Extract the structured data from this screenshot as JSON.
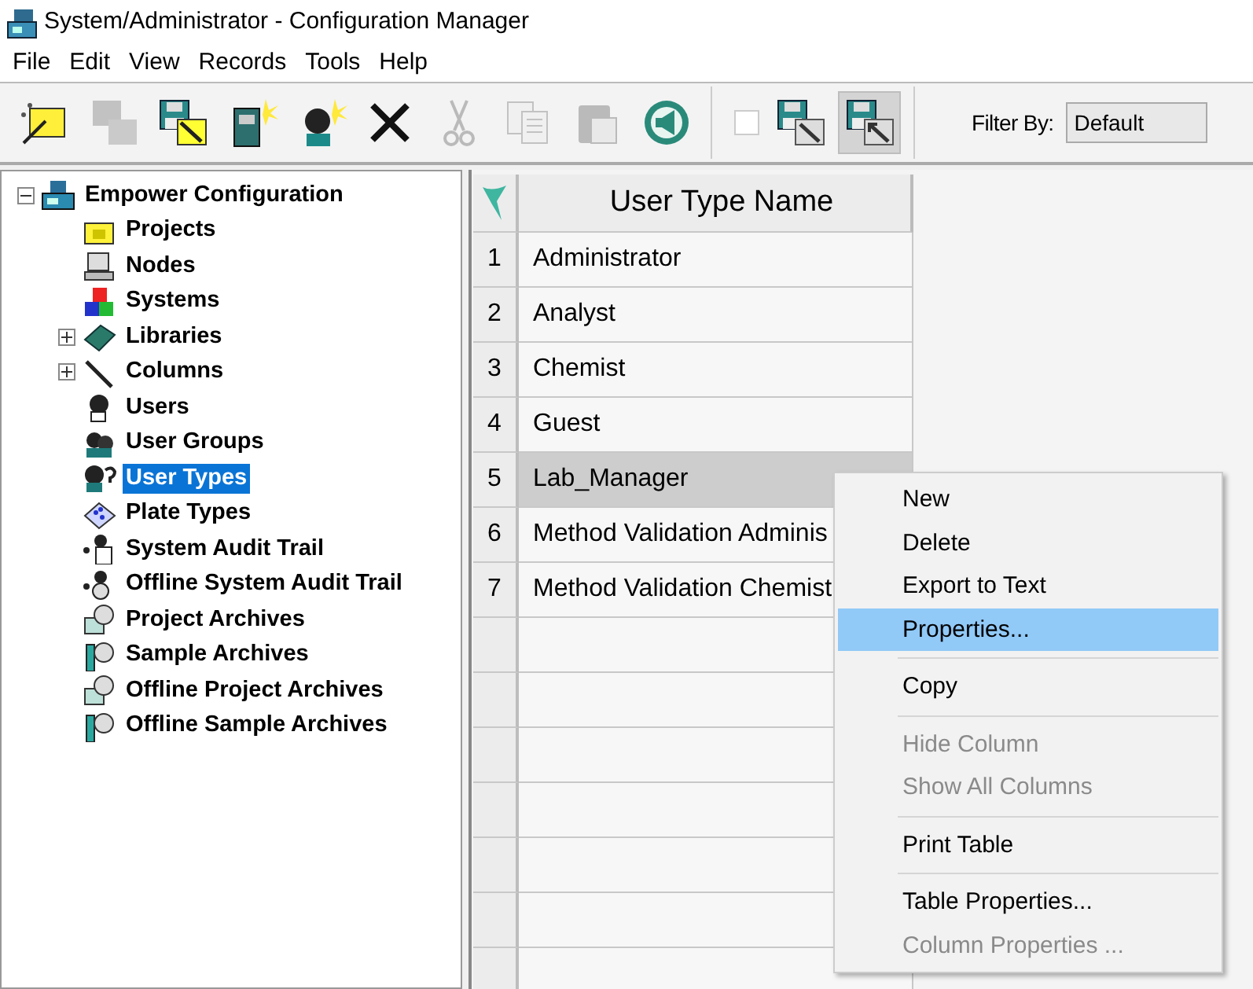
{
  "window": {
    "title": "System/Administrator - Configuration Manager"
  },
  "menu_bar": [
    "File",
    "Edit",
    "View",
    "Records",
    "Tools",
    "Help"
  ],
  "toolbar": {
    "buttons": [
      {
        "disabled": false,
        "pressed": false
      },
      {
        "disabled": true,
        "pressed": false
      },
      {
        "disabled": false,
        "pressed": false
      },
      {
        "disabled": false,
        "pressed": false
      },
      {
        "disabled": false,
        "pressed": false
      },
      {
        "disabled": false,
        "pressed": false
      },
      {
        "disabled": true,
        "pressed": false
      },
      {
        "disabled": true,
        "pressed": false
      },
      {
        "disabled": true,
        "pressed": false
      },
      {
        "disabled": false,
        "pressed": false
      },
      {
        "disabled": false,
        "pressed": false
      },
      {
        "disabled": false,
        "pressed": true
      }
    ],
    "checkbox_checked": false,
    "filter_label": "Filter By:",
    "filter_value": "Default"
  },
  "tree": [
    {
      "label": "Empower Configuration",
      "expanded": true,
      "selected": false,
      "children": [
        {
          "label": "Projects",
          "selected": false
        },
        {
          "label": "Nodes",
          "selected": false
        },
        {
          "label": "Systems",
          "selected": false
        },
        {
          "label": "Libraries",
          "expanded": false,
          "selected": false
        },
        {
          "label": "Columns",
          "expanded": false,
          "selected": false
        },
        {
          "label": "Users",
          "selected": false
        },
        {
          "label": "User Groups",
          "selected": false
        },
        {
          "label": "User Types",
          "selected": true
        },
        {
          "label": "Plate Types",
          "selected": false
        },
        {
          "label": "System Audit Trail",
          "selected": false
        },
        {
          "label": "Offline System Audit Trail",
          "selected": false
        },
        {
          "label": "Project Archives",
          "selected": false
        },
        {
          "label": "Sample Archives",
          "selected": false
        },
        {
          "label": "Offline Project Archives",
          "selected": false
        },
        {
          "label": "Offline Sample Archives",
          "selected": false
        }
      ]
    }
  ],
  "table": {
    "columns": [
      "User Type Name"
    ],
    "rows": [
      {
        "number": "1",
        "name": "Administrator",
        "selected": false
      },
      {
        "number": "2",
        "name": "Analyst",
        "selected": false
      },
      {
        "number": "3",
        "name": "Chemist",
        "selected": false
      },
      {
        "number": "4",
        "name": "Guest",
        "selected": false
      },
      {
        "number": "5",
        "name": "Lab_Manager",
        "selected": true
      },
      {
        "number": "6",
        "name": "Method Validation Adminis",
        "selected": false
      },
      {
        "number": "7",
        "name": "Method Validation Chemist",
        "selected": false
      }
    ]
  },
  "context_menu": [
    {
      "kind": "item",
      "label": "New",
      "disabled": false,
      "selected": false
    },
    {
      "kind": "item",
      "label": "Delete",
      "disabled": false,
      "selected": false
    },
    {
      "kind": "item",
      "label": "Export to Text",
      "disabled": false,
      "selected": false
    },
    {
      "kind": "item",
      "label": "Properties...",
      "disabled": false,
      "selected": true
    },
    {
      "kind": "separator"
    },
    {
      "kind": "item",
      "label": "Copy",
      "disabled": false,
      "selected": false
    },
    {
      "kind": "separator"
    },
    {
      "kind": "item",
      "label": "Hide Column",
      "disabled": true,
      "selected": false
    },
    {
      "kind": "item",
      "label": "Show All Columns",
      "disabled": true,
      "selected": false
    },
    {
      "kind": "separator"
    },
    {
      "kind": "item",
      "label": "Print Table",
      "disabled": false,
      "selected": false
    },
    {
      "kind": "separator"
    },
    {
      "kind": "item",
      "label": "Table Properties...",
      "disabled": false,
      "selected": false
    },
    {
      "kind": "item",
      "label": "Column Properties ...",
      "disabled": true,
      "selected": false
    }
  ]
}
